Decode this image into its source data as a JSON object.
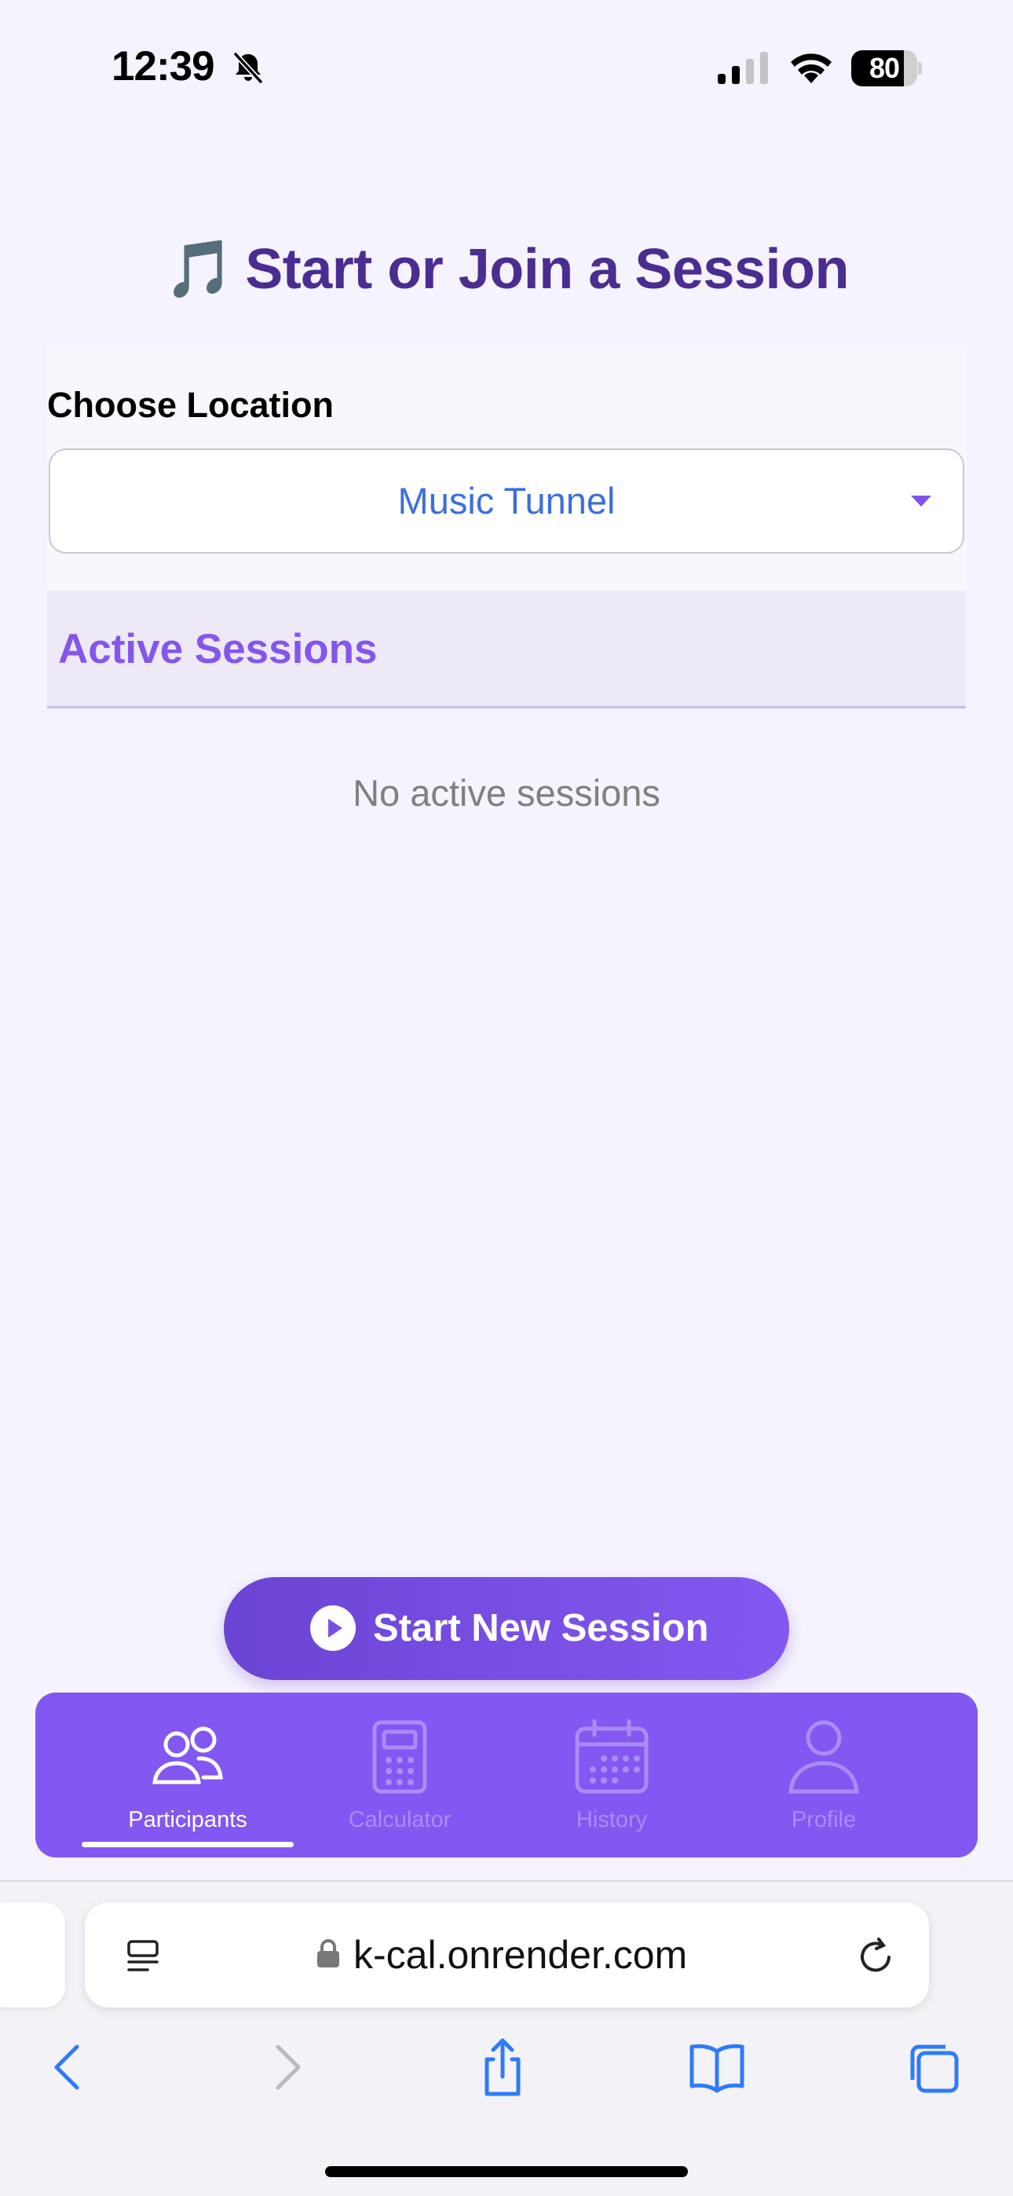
{
  "status_bar": {
    "time": "12:39",
    "battery": "80",
    "battery_level": 0.8,
    "icons": [
      "bell-slash-icon",
      "cellular-signal-icon",
      "wifi-icon",
      "battery-icon"
    ]
  },
  "header": {
    "icon": "🎵",
    "title": "Start or Join a Session"
  },
  "location": {
    "label": "Choose Location",
    "selected": "Music Tunnel"
  },
  "sessions": {
    "title": "Active Sessions",
    "empty_message": "No active sessions"
  },
  "start_button": {
    "label": "Start New Session",
    "icon": "play-circle-icon"
  },
  "bottom_nav": {
    "items": [
      {
        "label": "Participants",
        "icon": "participants-icon",
        "active": true
      },
      {
        "label": "Calculator",
        "icon": "calculator-icon",
        "active": false
      },
      {
        "label": "History",
        "icon": "calendar-icon",
        "active": false
      },
      {
        "label": "Profile",
        "icon": "profile-icon",
        "active": false
      }
    ]
  },
  "browser": {
    "address": "k-cal.onrender.com",
    "toolbar_icons": [
      "back-icon",
      "forward-icon",
      "share-icon",
      "bookmarks-icon",
      "tabs-icon"
    ]
  },
  "colors": {
    "accent": "#8357f1",
    "title": "#4a2d91",
    "link_blue": "#3d6fd8",
    "background": "#f5f3fd"
  }
}
